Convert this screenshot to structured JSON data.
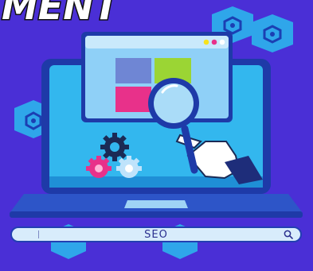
{
  "header": {
    "title_fragment": "MENT"
  },
  "search_bar": {
    "text": "SEO",
    "icon": "search-icon"
  },
  "icons": {
    "gear": "gear-icon",
    "magnifier": "magnifier-icon",
    "hand": "hand-icon",
    "hexagon": "hexagon-badge-icon",
    "window_dots": "window-dots"
  },
  "colors": {
    "background": "#4a2fd6",
    "hexagon": "#2fa6ea",
    "screen": "#33b7ee",
    "window": "#8fd0f7",
    "tile_blue": "#6f86d4",
    "tile_green": "#9bd534",
    "tile_pink": "#e8318a",
    "tile_light": "#cde9fb",
    "gear_dark": "#1b2a55",
    "gear_pink": "#e8318a",
    "gear_light": "#bfe3fb"
  }
}
